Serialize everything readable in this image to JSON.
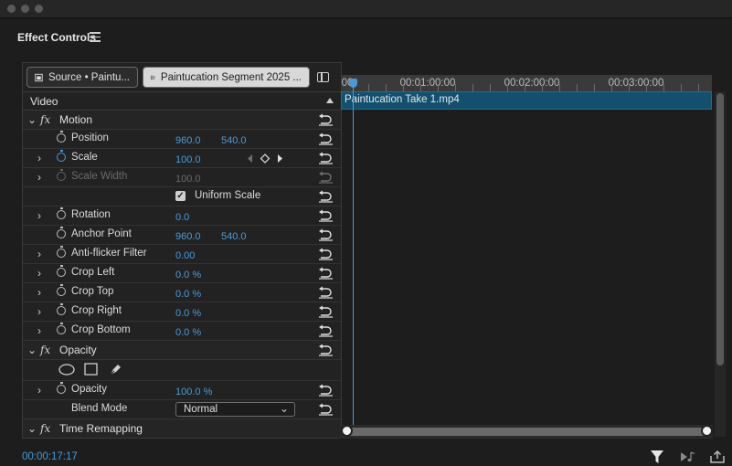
{
  "panel": {
    "title": "Effect Controls"
  },
  "tabs": [
    {
      "label": "Source • Paintu...",
      "active": false
    },
    {
      "label": "Paintucation Segment 2025 ...",
      "active": true
    }
  ],
  "video_section": {
    "label": "Video"
  },
  "motion": {
    "label": "Motion",
    "position": {
      "label": "Position",
      "x": "960.0",
      "y": "540.0"
    },
    "scale": {
      "label": "Scale",
      "value": "100.0"
    },
    "scale_width": {
      "label": "Scale Width",
      "value": "100.0"
    },
    "uniform_scale": {
      "label": "Uniform Scale",
      "checked": true
    },
    "rotation": {
      "label": "Rotation",
      "value": "0.0"
    },
    "anchor_point": {
      "label": "Anchor Point",
      "x": "960.0",
      "y": "540.0"
    },
    "anti_flicker": {
      "label": "Anti-flicker Filter",
      "value": "0.00"
    },
    "crop_left": {
      "label": "Crop Left",
      "value": "0.0 %"
    },
    "crop_top": {
      "label": "Crop Top",
      "value": "0.0 %"
    },
    "crop_right": {
      "label": "Crop Right",
      "value": "0.0 %"
    },
    "crop_bottom": {
      "label": "Crop Bottom",
      "value": "0.0 %"
    }
  },
  "opacity": {
    "label": "Opacity",
    "opacity_param": {
      "label": "Opacity",
      "value": "100.0 %"
    },
    "blend_mode": {
      "label": "Blend Mode",
      "value": "Normal"
    }
  },
  "time_remapping": {
    "label": "Time Remapping"
  },
  "timeline": {
    "ruler_labels": [
      "00:01:00:00",
      "00:02:00:00",
      "00:03:00:00"
    ],
    "ruler_start_fragment": "00",
    "clip_name": "Paintucation Take 1.mp4"
  },
  "footer": {
    "timecode": "00:00:17:17"
  },
  "colors": {
    "accent": "#4a9ad8",
    "clip": "#13506e",
    "background": "#1d1d1d"
  }
}
